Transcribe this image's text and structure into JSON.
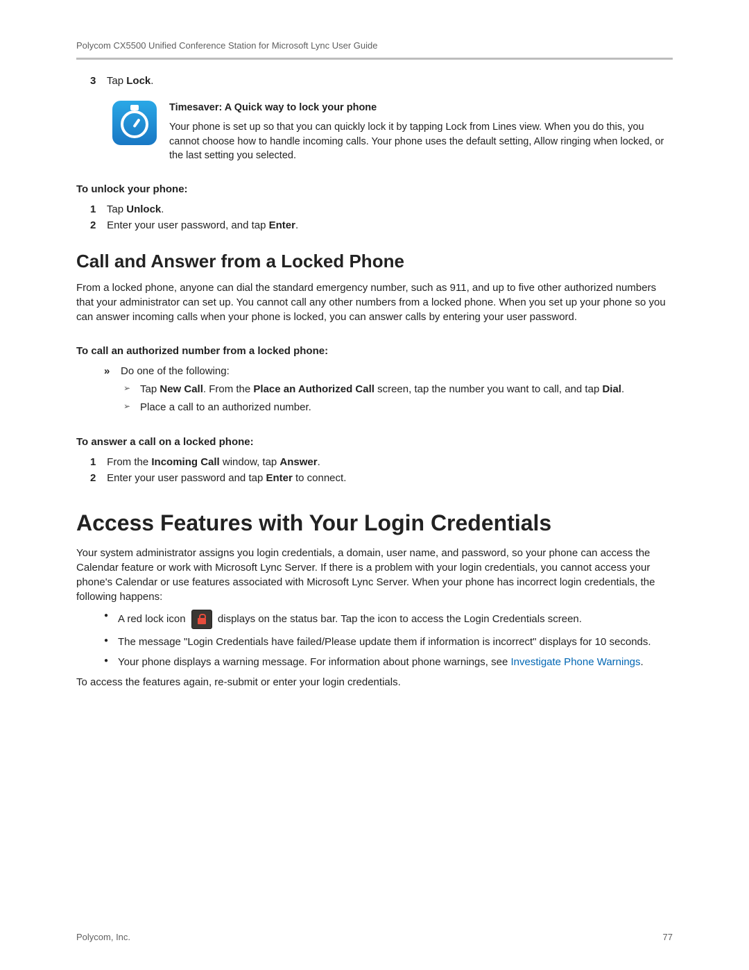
{
  "header": "Polycom CX5500 Unified Conference Station for Microsoft Lync User Guide",
  "step3": {
    "num": "3",
    "pre": "Tap ",
    "bold": "Lock",
    "post": "."
  },
  "timesaver": {
    "title": "Timesaver: A Quick way to lock your phone",
    "body": "Your phone is set up so that you can quickly lock it by tapping Lock from Lines view. When you do this, you cannot choose how to handle incoming calls. Your phone uses the default setting, Allow ringing when locked, or the last setting you selected."
  },
  "unlock": {
    "heading": "To unlock your phone:",
    "s1": {
      "num": "1",
      "pre": "Tap ",
      "bold": "Unlock",
      "post": "."
    },
    "s2": {
      "num": "2",
      "pre": "Enter your user password, and tap ",
      "bold": "Enter",
      "post": "."
    }
  },
  "section2": {
    "title": "Call and Answer from a Locked Phone",
    "para": "From a locked phone, anyone can dial the standard emergency number, such as 911, and up to five other authorized numbers that your administrator can set up. You cannot call any other numbers from a locked phone. When you set up your phone so you can answer incoming calls when your phone is locked, you can answer calls by entering your user password.",
    "subA": "To call an authorized number from a locked phone:",
    "arrow1": "Do one of the following:",
    "tri1": {
      "pre": "Tap ",
      "b1": "New Call",
      "mid": ". From the ",
      "b2": "Place an Authorized Call",
      "mid2": " screen, tap the number you want to call, and tap ",
      "b3": "Dial",
      "post": "."
    },
    "tri2": "Place a call to an authorized number.",
    "subB": "To answer a call on a locked phone:",
    "b1": {
      "num": "1",
      "pre": "From the ",
      "bold1": "Incoming Call",
      "mid": " window, tap ",
      "bold2": "Answer",
      "post": "."
    },
    "b2": {
      "num": "2",
      "pre": "Enter your user password and tap ",
      "bold": "Enter",
      "post": " to connect."
    }
  },
  "section3": {
    "title": "Access Features with Your Login Credentials",
    "para": "Your system administrator assigns you login credentials, a domain, user name, and password, so your phone can access the Calendar feature or work with Microsoft Lync Server. If there is a problem with your login credentials, you cannot access your phone's Calendar or use features associated with Microsoft Lync Server. When your phone has incorrect login credentials, the following happens:",
    "bul1": {
      "pre": "A red lock icon ",
      "post": " displays on the status bar. Tap the icon to access the Login Credentials screen."
    },
    "bul2": "The message \"Login Credentials have failed/Please update them if information is incorrect\" displays for 10 seconds.",
    "bul3": {
      "pre": "Your phone displays a warning message. For information about phone warnings, see ",
      "link": "Investigate Phone Warnings",
      "post": "."
    },
    "close": "To access the features again, re-submit or enter your login credentials."
  },
  "footer": {
    "company": "Polycom, Inc.",
    "page": "77"
  }
}
